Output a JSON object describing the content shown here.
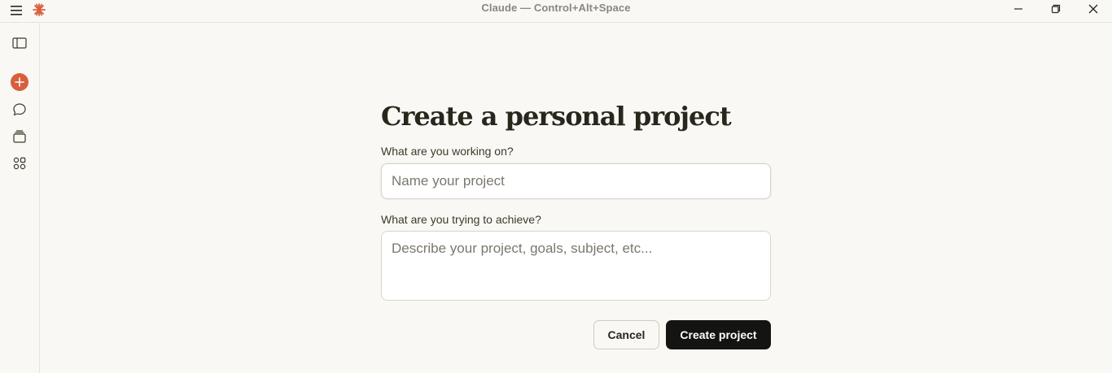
{
  "window": {
    "title": "Claude — Control+Alt+Space",
    "icons": {
      "menu": "hamburger-menu-icon",
      "logo": "claude-logo-icon",
      "minimize": "minimize-icon",
      "restore": "restore-icon",
      "close": "close-icon"
    }
  },
  "sidebar": {
    "items": [
      {
        "name": "toggle-sidebar",
        "icon": "sidebar-panel-icon"
      },
      {
        "name": "new-chat",
        "icon": "plus-icon"
      },
      {
        "name": "chats",
        "icon": "chat-bubbles-icon"
      },
      {
        "name": "projects",
        "icon": "projects-stack-icon"
      },
      {
        "name": "artifacts",
        "icon": "artifacts-grid-icon"
      }
    ],
    "accent": "#d75f3b"
  },
  "form": {
    "heading": "Create a personal project",
    "name_label": "What are you working on?",
    "name_placeholder": "Name your project",
    "name_value": "",
    "desc_label": "What are you trying to achieve?",
    "desc_placeholder": "Describe your project, goals, subject, etc...",
    "desc_value": "",
    "cancel_label": "Cancel",
    "create_label": "Create project"
  }
}
